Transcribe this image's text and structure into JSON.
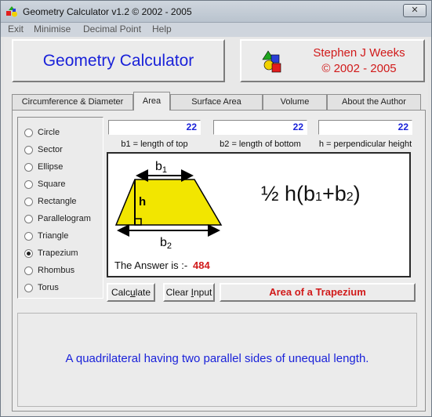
{
  "window": {
    "title": "Geometry Calculator v1.2 ©  2002 - 2005",
    "close_label": "✕"
  },
  "menu": [
    "Exit",
    "Minimise",
    "Decimal Point",
    "Help"
  ],
  "header": {
    "app_title": "Geometry Calculator",
    "author_line1": "Stephen J Weeks",
    "author_line2": "© 2002 - 2005"
  },
  "tabs": [
    {
      "label": "Circumference & Diameter",
      "active": false
    },
    {
      "label": "Area",
      "active": true
    },
    {
      "label": "Surface Area",
      "active": false
    },
    {
      "label": "Volume",
      "active": false
    },
    {
      "label": "About the Author",
      "active": false
    }
  ],
  "shapes": [
    {
      "label": "Circle",
      "selected": false
    },
    {
      "label": "Sector",
      "selected": false
    },
    {
      "label": "Ellipse",
      "selected": false
    },
    {
      "label": "Square",
      "selected": false
    },
    {
      "label": "Rectangle",
      "selected": false
    },
    {
      "label": "Parallelogram",
      "selected": false
    },
    {
      "label": "Triangle",
      "selected": false
    },
    {
      "label": "Trapezium",
      "selected": true
    },
    {
      "label": "Rhombus",
      "selected": false
    },
    {
      "label": "Torus",
      "selected": false
    }
  ],
  "inputs": [
    {
      "value": "22",
      "label": "b1 = length of top"
    },
    {
      "value": "22",
      "label": "b2 = length of bottom"
    },
    {
      "value": "22",
      "label": "h = perpendicular height"
    }
  ],
  "diagram": {
    "top_label": "b",
    "top_sub": "1",
    "height_label": "h",
    "bottom_label": "b",
    "bottom_sub": "2",
    "fill_color": "#f2e600"
  },
  "formula": {
    "prefix": "½ h(b",
    "sub1": "1",
    "mid": "+b",
    "sub2": "2",
    "suffix": ")"
  },
  "answer": {
    "label": "The Answer is :-",
    "value": "484"
  },
  "buttons": {
    "calculate_pre": "Calc",
    "calculate_ul": "u",
    "calculate_post": "late",
    "clear_pre": "Clear ",
    "clear_ul": "I",
    "clear_post": "nput"
  },
  "result_title": "Area of a Trapezium",
  "description": "A quadrilateral having two parallel sides of unequal length."
}
